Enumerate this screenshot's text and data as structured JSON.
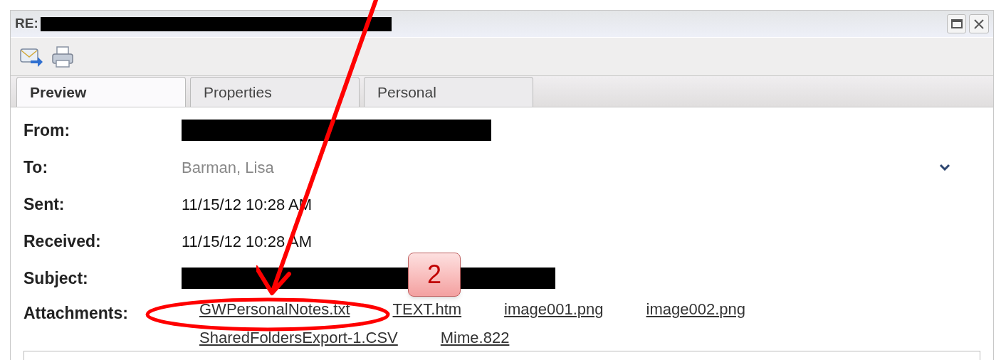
{
  "window": {
    "title": "RE:",
    "title_redacted": true
  },
  "tabs": [
    {
      "label": "Preview",
      "selected": true
    },
    {
      "label": "Properties",
      "selected": false
    },
    {
      "label": "Personal",
      "selected": false
    }
  ],
  "fields": [
    {
      "label": "From:",
      "redacted": true
    },
    {
      "label": "To:",
      "value": "Barman, Lisa",
      "muted": true,
      "expandable": true
    },
    {
      "label": "Sent:",
      "value": "11/15/12 10:28 AM"
    },
    {
      "label": "Received:",
      "value": "11/15/12 10:28 AM"
    },
    {
      "label": "Subject:",
      "redacted": true
    }
  ],
  "attachments": {
    "label": "Attachments:",
    "files": [
      "GWPersonalNotes.txt",
      "TEXT.htm",
      "image001.png",
      "image002.png",
      "SharedFoldersExport-1.CSV",
      "Mime.822"
    ]
  },
  "annotation": {
    "callout": "2"
  }
}
